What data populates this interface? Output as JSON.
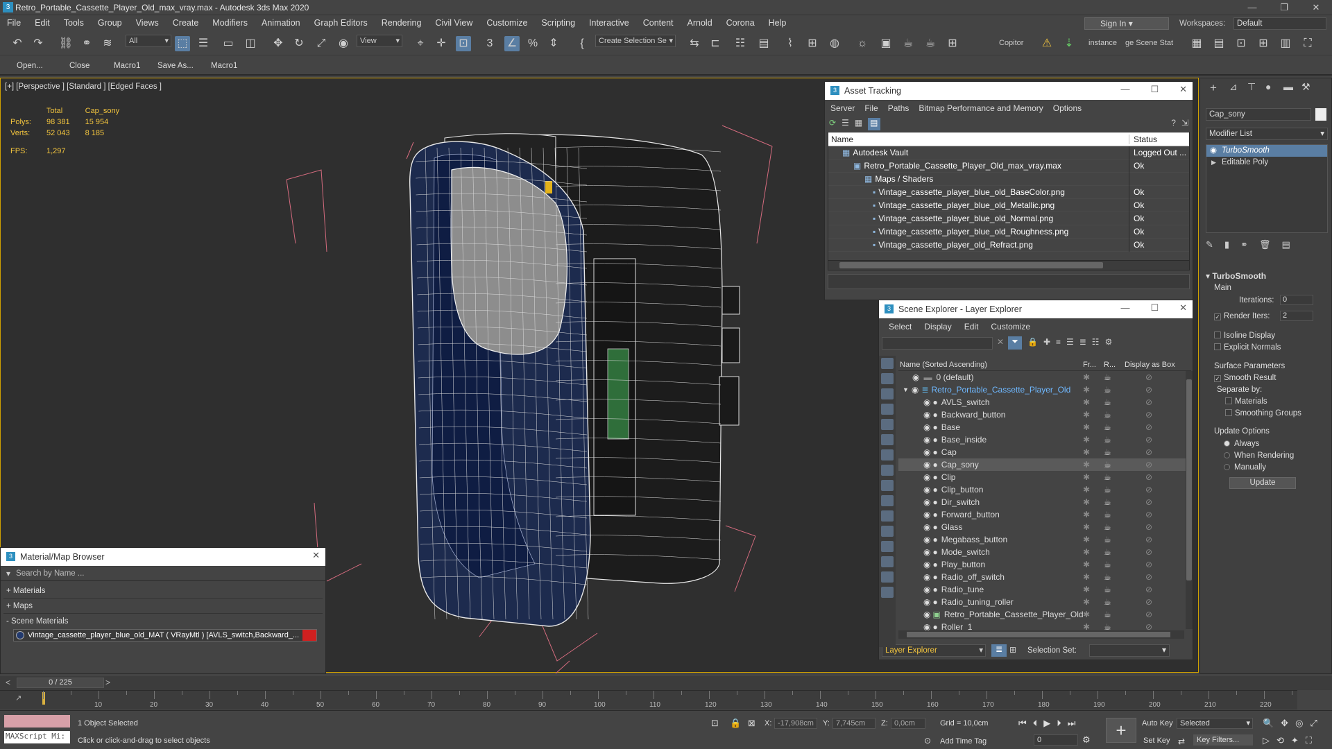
{
  "window": {
    "title": "Retro_Portable_Cassette_Player_Old_max_vray.max - Autodesk 3ds Max 2020",
    "app_icon": "3",
    "controls": [
      "—",
      "❐",
      "✕"
    ]
  },
  "menu": [
    "File",
    "Edit",
    "Tools",
    "Group",
    "Views",
    "Create",
    "Modifiers",
    "Animation",
    "Graph Editors",
    "Rendering",
    "Civil View",
    "Customize",
    "Scripting",
    "Interactive",
    "Content",
    "Arnold",
    "Corona",
    "Help"
  ],
  "signin": "Sign In",
  "workspaces": {
    "label": "Workspaces:",
    "value": "Default"
  },
  "toolbar": {
    "filter": "All",
    "view": "View",
    "create_selection": "Create Selection Se",
    "copitor": "Copitor",
    "instance": "instance",
    "scene_stat": "ge Scene Stat"
  },
  "subbar": [
    "Open...",
    "Close",
    "Macro1",
    "Save As...",
    "Macro1"
  ],
  "viewport": {
    "label": "[+] [Perspective ] [Standard ] [Edged Faces ]",
    "stats": {
      "headers": [
        "Total",
        "Cap_sony"
      ],
      "rows": [
        {
          "label": "Polys:",
          "total": "98 381",
          "sel": "15 954"
        },
        {
          "label": "Verts:",
          "total": "52 043",
          "sel": "8 185"
        }
      ],
      "fps_label": "FPS:",
      "fps": "1,297"
    }
  },
  "asset_tracking": {
    "title": "Asset Tracking",
    "menu": [
      "Server",
      "File",
      "Paths",
      "Bitmap Performance and Memory",
      "Options"
    ],
    "cols": [
      "Name",
      "Status"
    ],
    "rows": [
      {
        "name": "Autodesk Vault",
        "status": "Logged Out ..."
      },
      {
        "name": "Retro_Portable_Cassette_Player_Old_max_vray.max",
        "status": "Ok"
      },
      {
        "name": "Maps / Shaders",
        "status": ""
      },
      {
        "name": "Vintage_cassette_player_blue_old_BaseColor.png",
        "status": "Ok"
      },
      {
        "name": "Vintage_cassette_player_blue_old_Metallic.png",
        "status": "Ok"
      },
      {
        "name": "Vintage_cassette_player_blue_old_Normal.png",
        "status": "Ok"
      },
      {
        "name": "Vintage_cassette_player_blue_old_Roughness.png",
        "status": "Ok"
      },
      {
        "name": "Vintage_cassette_player_old_Refract.png",
        "status": "Ok"
      }
    ]
  },
  "scene_explorer": {
    "title": "Scene Explorer - Layer Explorer",
    "menu": [
      "Select",
      "Display",
      "Edit",
      "Customize"
    ],
    "cols": [
      "Name (Sorted Ascending)",
      "Fr...",
      "R...",
      "Display as Box"
    ],
    "rows": [
      {
        "name": "0 (default)",
        "level": 0
      },
      {
        "name": "Retro_Portable_Cassette_Player_Old",
        "level": 1,
        "layer": true
      },
      {
        "name": "AVLS_switch",
        "level": 2
      },
      {
        "name": "Backward_button",
        "level": 2
      },
      {
        "name": "Base",
        "level": 2
      },
      {
        "name": "Base_inside",
        "level": 2
      },
      {
        "name": "Cap",
        "level": 2
      },
      {
        "name": "Cap_sony",
        "level": 2,
        "selected": true
      },
      {
        "name": "Clip",
        "level": 2
      },
      {
        "name": "Clip_button",
        "level": 2
      },
      {
        "name": "Dir_switch",
        "level": 2
      },
      {
        "name": "Forward_button",
        "level": 2
      },
      {
        "name": "Glass",
        "level": 2
      },
      {
        "name": "Megabass_button",
        "level": 2
      },
      {
        "name": "Mode_switch",
        "level": 2
      },
      {
        "name": "Play_button",
        "level": 2
      },
      {
        "name": "Radio_off_switch",
        "level": 2
      },
      {
        "name": "Radio_tune",
        "level": 2
      },
      {
        "name": "Radio_tuning_roller",
        "level": 2
      },
      {
        "name": "Retro_Portable_Cassette_Player_Old",
        "level": 2,
        "group": true
      },
      {
        "name": "Roller_1",
        "level": 2
      }
    ],
    "footer_layer": "Layer Explorer",
    "selection_set_label": "Selection Set:"
  },
  "material_browser": {
    "title": "Material/Map Browser",
    "search_placeholder": "Search by Name ...",
    "sections": [
      "+ Materials",
      "+ Maps",
      "- Scene Materials"
    ],
    "material": "Vintage_cassette_player_blue_old_MAT ( VRayMtl ) [AVLS_switch,Backward_..."
  },
  "command_panel": {
    "object_name": "Cap_sony",
    "modifier_list": "Modifier List",
    "stack": [
      "TurboSmooth",
      "Editable Poly"
    ],
    "rollout": "TurboSmooth",
    "main": "Main",
    "iterations_label": "Iterations:",
    "iterations": "0",
    "render_iters_label": "Render Iters:",
    "render_iters": "2",
    "isoline": "Isoline Display",
    "explicit": "Explicit Normals",
    "surface": "Surface Parameters",
    "smooth_result": "Smooth Result",
    "separate_by": "Separate by:",
    "materials": "Materials",
    "smoothing_groups": "Smoothing Groups",
    "update_options": "Update Options",
    "always": "Always",
    "when_rendering": "When Rendering",
    "manually": "Manually",
    "update": "Update"
  },
  "timeline": {
    "frame": "0 / 225",
    "ticks": [
      "0",
      "10",
      "20",
      "30",
      "40",
      "50",
      "60",
      "70",
      "80",
      "90",
      "100",
      "110",
      "120",
      "130",
      "140",
      "150",
      "160",
      "170",
      "180",
      "190",
      "200",
      "210",
      "220"
    ]
  },
  "status": {
    "maxscript": "MAXScript Mi:",
    "selected": "1 Object Selected",
    "prompt": "Click or click-and-drag to select objects",
    "x_label": "X:",
    "x": "-17,908cm",
    "y_label": "Y:",
    "y": "7,745cm",
    "z_label": "Z:",
    "z": "0,0cm",
    "grid": "Grid = 10,0cm",
    "add_time_tag": "Add Time Tag",
    "auto_key": "Auto Key",
    "set_key": "Set Key",
    "selected_dd": "Selected",
    "key_filters": "Key Filters...",
    "frame_input": "0"
  }
}
